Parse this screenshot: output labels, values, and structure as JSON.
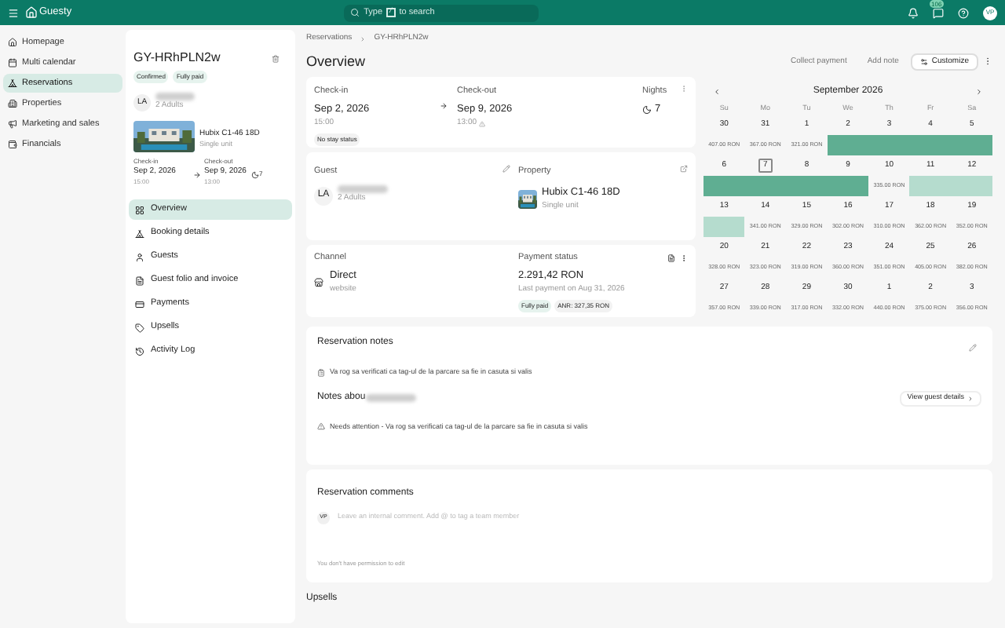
{
  "header": {
    "brand": "Guesty",
    "search": {
      "before": "Type",
      "key": "/",
      "after": "to search"
    },
    "badge": "106",
    "avatar": "VP"
  },
  "nav": [
    {
      "label": "Homepage",
      "selected": false
    },
    {
      "label": "Multi calendar",
      "selected": false
    },
    {
      "label": "Reservations",
      "selected": true
    },
    {
      "label": "Properties",
      "selected": false
    },
    {
      "label": "Marketing and sales",
      "selected": false
    },
    {
      "label": "Financials",
      "selected": false
    }
  ],
  "summary": {
    "code": "GY-HRhPLN2w",
    "tags": [
      "Confirmed",
      "Fully paid"
    ],
    "initials": "LA",
    "guests": "2 Adults",
    "property": "Hubix C1-46 18D",
    "unit": "Single unit",
    "checkin_label": "Check-in",
    "checkin": "Sep 2, 2026",
    "checkin_time": "15:00",
    "checkout_label": "Check-out",
    "checkout": "Sep 9, 2026",
    "checkout_time": "13:00",
    "nights": "7"
  },
  "sections": [
    {
      "label": "Overview",
      "selected": true
    },
    {
      "label": "Booking details",
      "selected": false
    },
    {
      "label": "Guests",
      "selected": false
    },
    {
      "label": "Guest folio and invoice",
      "selected": false
    },
    {
      "label": "Payments",
      "selected": false
    },
    {
      "label": "Upsells",
      "selected": false
    },
    {
      "label": "Activity Log",
      "selected": false
    }
  ],
  "breadcrumb": [
    "Reservations",
    "GY-HRhPLN2w"
  ],
  "title": "Overview",
  "actions": [
    "Collect payment",
    "Add note",
    "Customize"
  ],
  "stay": {
    "checkin_label": "Check-in",
    "checkin": "Sep 2, 2026",
    "checkin_time": "15:00",
    "status": "No stay status",
    "checkout_label": "Check-out",
    "checkout": "Sep 9, 2026",
    "checkout_time": "13:00",
    "nights_label": "Nights",
    "nights": "7"
  },
  "guest": {
    "label": "Guest",
    "initials": "LA",
    "sub": "2 Adults"
  },
  "property": {
    "label": "Property",
    "name": "Hubix C1-46 18D",
    "unit": "Single unit"
  },
  "channel": {
    "label": "Channel",
    "name": "Direct",
    "sub": "website"
  },
  "payment": {
    "label": "Payment status",
    "amount": "2.291,42 RON",
    "last": "Last payment on Aug 31, 2026",
    "tags": [
      "Fully paid",
      "ANR: 327,35 RON"
    ]
  },
  "calendar": {
    "month": "September 2026",
    "weekdays": [
      "Su",
      "Mo",
      "Tu",
      "We",
      "Th",
      "Fr",
      "Sa"
    ],
    "weeks": [
      [
        {
          "day": "30",
          "price": "407.00 RON",
          "kind": "price",
          "today": false
        },
        {
          "day": "31",
          "price": "367.00 RON",
          "kind": "price",
          "today": false
        },
        {
          "day": "1",
          "price": "321.00 RON",
          "kind": "price",
          "today": false
        },
        {
          "day": "2",
          "kind": "booked",
          "today": false
        },
        {
          "day": "3",
          "kind": "booked",
          "today": false
        },
        {
          "day": "4",
          "kind": "booked",
          "today": false
        },
        {
          "day": "5",
          "kind": "booked",
          "today": false
        }
      ],
      [
        {
          "day": "6",
          "kind": "booked",
          "today": false
        },
        {
          "day": "7",
          "kind": "booked",
          "today": true
        },
        {
          "day": "8",
          "kind": "booked",
          "today": false
        },
        {
          "day": "9",
          "kind": "booked",
          "today": false
        },
        {
          "day": "10",
          "price": "335.00 RON",
          "kind": "price",
          "today": false
        },
        {
          "day": "11",
          "kind": "blocked",
          "today": false
        },
        {
          "day": "12",
          "kind": "blocked",
          "today": false
        }
      ],
      [
        {
          "day": "13",
          "kind": "blocked",
          "today": false
        },
        {
          "day": "14",
          "price": "341.00 RON",
          "kind": "price",
          "today": false
        },
        {
          "day": "15",
          "price": "329.00 RON",
          "kind": "price",
          "today": false
        },
        {
          "day": "16",
          "price": "302.00 RON",
          "kind": "price",
          "today": false
        },
        {
          "day": "17",
          "price": "310.00 RON",
          "kind": "price",
          "today": false
        },
        {
          "day": "18",
          "price": "362.00 RON",
          "kind": "price",
          "today": false
        },
        {
          "day": "19",
          "price": "352.00 RON",
          "kind": "price",
          "today": false
        }
      ],
      [
        {
          "day": "20",
          "price": "328.00 RON",
          "kind": "price",
          "today": false
        },
        {
          "day": "21",
          "price": "323.00 RON",
          "kind": "price",
          "today": false
        },
        {
          "day": "22",
          "price": "319.00 RON",
          "kind": "price",
          "today": false
        },
        {
          "day": "23",
          "price": "360.00 RON",
          "kind": "price",
          "today": false
        },
        {
          "day": "24",
          "price": "351.00 RON",
          "kind": "price",
          "today": false
        },
        {
          "day": "25",
          "price": "405.00 RON",
          "kind": "price",
          "today": false
        },
        {
          "day": "26",
          "price": "382.00 RON",
          "kind": "price",
          "today": false
        }
      ],
      [
        {
          "day": "27",
          "price": "357.00 RON",
          "kind": "price",
          "today": false
        },
        {
          "day": "28",
          "price": "339.00 RON",
          "kind": "price",
          "today": false
        },
        {
          "day": "29",
          "price": "317.00 RON",
          "kind": "price",
          "today": false
        },
        {
          "day": "30",
          "price": "332.00 RON",
          "kind": "price",
          "today": false
        },
        {
          "day": "1",
          "price": "440.00 RON",
          "kind": "price",
          "today": false
        },
        {
          "day": "2",
          "price": "375.00 RON",
          "kind": "price",
          "today": false
        },
        {
          "day": "3",
          "price": "356.00 RON",
          "kind": "price",
          "today": false
        }
      ]
    ]
  },
  "notes": {
    "title": "Reservation notes",
    "note": "Va rog sa verificati ca tag-ul de la parcare sa fie in casuta si valis",
    "guest_title": "Notes abou",
    "view": "View guest details",
    "guest_note": "Needs attention - Va rog sa verificati ca tag-ul de la parcare sa fie in casuta si valis"
  },
  "comments": {
    "title": "Reservation comments",
    "avatar": "VP",
    "placeholder": "Leave an internal comment. Add @ to tag a team member",
    "permission": "You don't have permission to edit"
  },
  "upsells": {
    "title": "Upsells"
  }
}
